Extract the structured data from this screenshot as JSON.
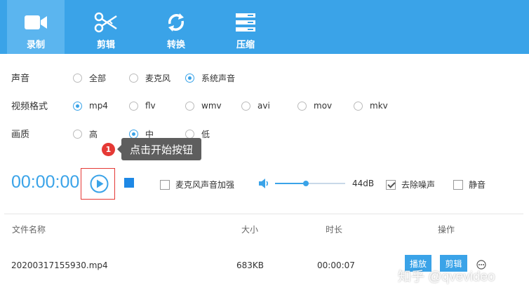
{
  "toolbar": {
    "items": [
      {
        "label": "录制",
        "icon": "video-camera-icon",
        "active": true
      },
      {
        "label": "剪辑",
        "icon": "scissors-icon",
        "active": false
      },
      {
        "label": "转换",
        "icon": "convert-icon",
        "active": false
      },
      {
        "label": "压缩",
        "icon": "compress-icon",
        "active": false
      }
    ]
  },
  "options": {
    "audio": {
      "label": "声音",
      "choices": [
        "全部",
        "麦克风",
        "系统声音"
      ],
      "selected": "系统声音"
    },
    "format": {
      "label": "视频格式",
      "choices": [
        "mp4",
        "flv",
        "wmv",
        "avi",
        "mov",
        "mkv"
      ],
      "selected": "mp4"
    },
    "quality": {
      "label": "画质",
      "choices": [
        "高",
        "中",
        "低"
      ],
      "selected": "中"
    }
  },
  "tooltip": {
    "badge": "1",
    "text": "点击开始按钮"
  },
  "controls": {
    "timer": "00:00:00",
    "mic_boost_label": "麦克风声音加强",
    "mic_boost_checked": false,
    "volume_db": "44dB",
    "volume_level_percent": 44,
    "denoise_label": "去除噪声",
    "denoise_checked": true,
    "mute_label": "静音",
    "mute_checked": false
  },
  "table": {
    "headers": {
      "name": "文件名称",
      "size": "大小",
      "duration": "时长",
      "actions": "操作"
    },
    "rows": [
      {
        "name": "20200317155930.mp4",
        "size": "683KB",
        "duration": "00:00:07",
        "play_label": "播放",
        "edit_label": "剪辑"
      }
    ]
  },
  "watermark": "知乎 @qvevideo",
  "colors": {
    "accent": "#3aa3e8",
    "toolbar_active": "#5bb5ef",
    "highlight_red": "#e53935",
    "tooltip_bg": "#5e5e5e"
  }
}
